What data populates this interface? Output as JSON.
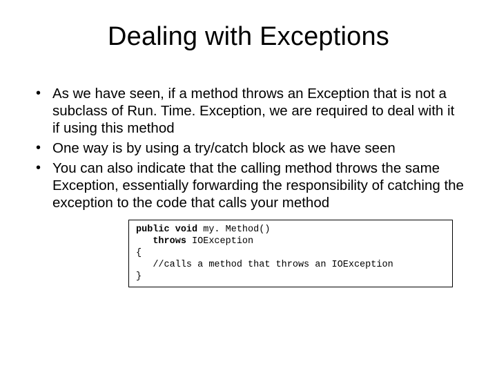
{
  "title": "Dealing with Exceptions",
  "bullets": [
    "As we have seen, if a method throws an Exception that is not a subclass of Run. Time. Exception, we are required to deal with it if using this method",
    "One way is by using a try/catch block as we have seen",
    "You can also indicate that the calling method throws the same Exception, essentially forwarding the responsibility of catching the exception to the code that calls your method"
  ],
  "code": {
    "kw_public": "public",
    "kw_void": "void",
    "sig_rest": " my. Method()",
    "indent_throws": "   ",
    "kw_throws": "throws",
    "throws_rest": " IOException",
    "brace_open": "{",
    "body_indent": "   ",
    "body_comment": "//calls a method that throws an IOException",
    "brace_close": "}"
  }
}
